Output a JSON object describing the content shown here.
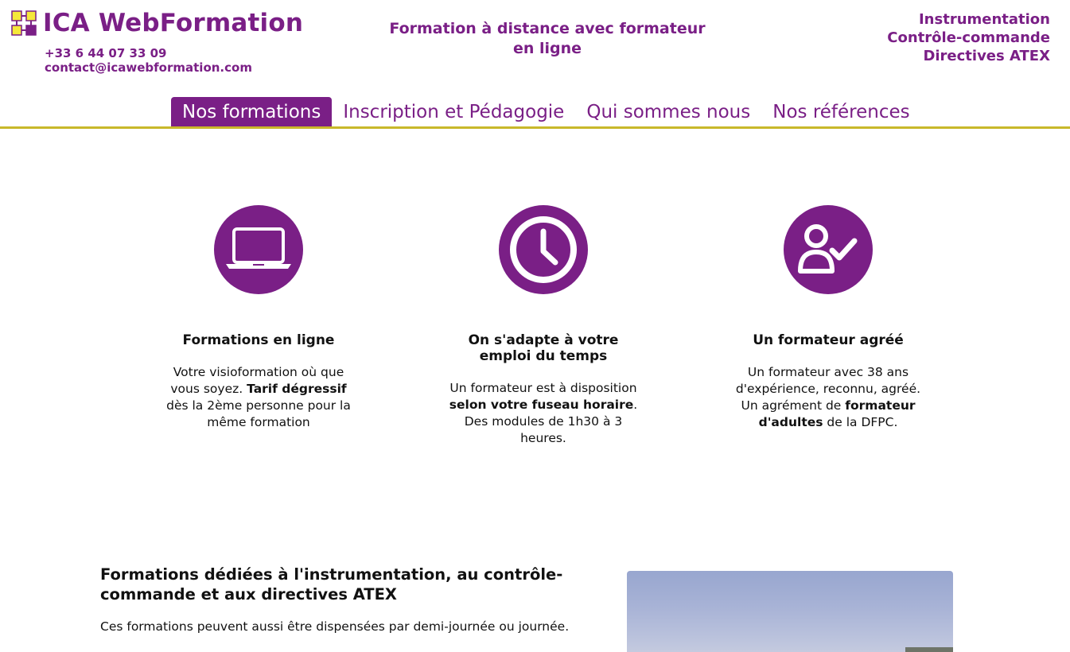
{
  "header": {
    "logo_text": "ICA WebFormation",
    "phone": "+33 6 44 07 33 09",
    "email": "contact@icawebformation.com",
    "tagline_line1": "Formation à distance avec formateur",
    "tagline_line2": "en ligne",
    "domain1": "Instrumentation",
    "domain2": "Contrôle-commande",
    "domain3": "Directives ATEX"
  },
  "nav": {
    "items": [
      {
        "label": "Nos formations",
        "active": true
      },
      {
        "label": "Inscription et Pédagogie",
        "active": false
      },
      {
        "label": "Qui sommes nous",
        "active": false
      },
      {
        "label": "Nos références",
        "active": false
      }
    ]
  },
  "features": [
    {
      "icon": "laptop-icon",
      "title": "Formations en ligne",
      "text_a": "Votre visioformation où que vous soyez. ",
      "text_bold": "Tarif dégressif",
      "text_b": " dès la 2ème personne pour la même formation"
    },
    {
      "icon": "clock-icon",
      "title": "On s'adapte à votre emploi du temps",
      "text_a": "Un formateur est à disposition ",
      "text_bold": "selon votre fuseau horaire",
      "text_b": ".",
      "text_c": "Des modules de 1h30 à 3 heures."
    },
    {
      "icon": "user-check-icon",
      "title": "Un formateur agréé",
      "text_a": "Un formateur avec 38 ans d'expérience, reconnu, agréé.",
      "text_b": "Un agrément de ",
      "text_bold": "formateur d'adultes",
      "text_c": " de la DFPC."
    }
  ],
  "dedicated": {
    "title": "Formations dédiées à l'instrumentation, au contrôle-commande et aux directives ATEX",
    "subtitle": "Ces formations peuvent aussi être dispensées par demi-journée ou journée."
  },
  "colors": {
    "brand": "#7a1f86",
    "accent_line": "#c8b82a",
    "logo_yellow": "#f5e83a"
  }
}
